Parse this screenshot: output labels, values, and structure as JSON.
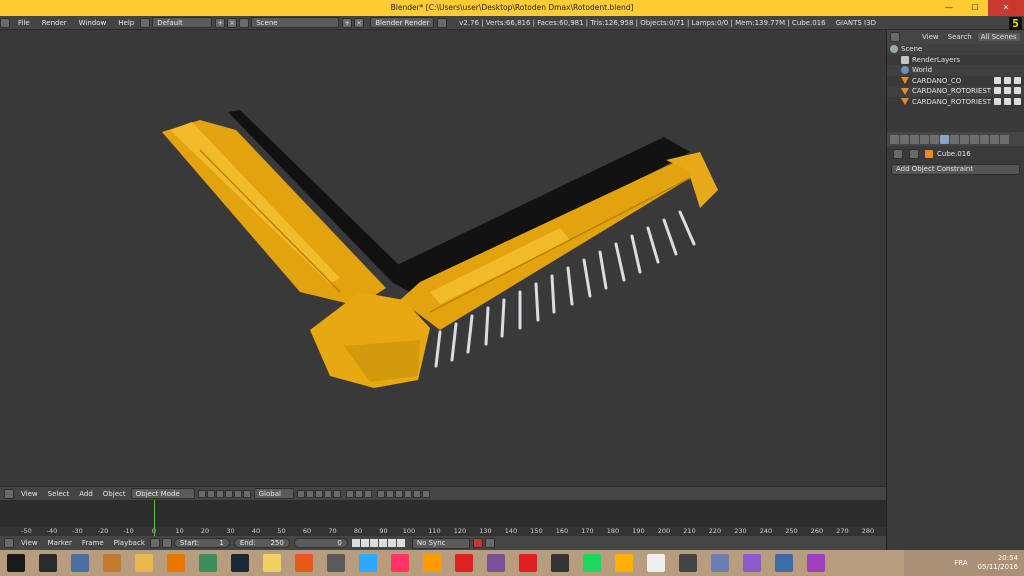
{
  "window": {
    "title": "Blender* [C:\\Users\\user\\Desktop\\Rotoden Dmax\\Rotodent.blend]",
    "minimize": "—",
    "maximize": "☐",
    "close": "✕"
  },
  "infobar": {
    "menus": [
      "File",
      "Render",
      "Window",
      "Help"
    ],
    "layout": "Default",
    "scene": "Scene",
    "engine": "Blender Render",
    "stats": "v2.76 | Verts:66,816 | Faces:60,981 | Tris:126,958 | Objects:0/71 | Lamps:0/0 | Mem:139.77M | Cube.016",
    "addon": "GIANTS I3D",
    "badge": "5"
  },
  "outliner": {
    "tabs": [
      "View",
      "Search",
      "All Scenes"
    ],
    "rows": [
      {
        "label": "Scene",
        "icon": "scene-icon"
      },
      {
        "label": "RenderLayers",
        "icon": "renderlayers-icon"
      },
      {
        "label": "World",
        "icon": "world-icon"
      },
      {
        "label": "CARDANO_CO",
        "icon": "mesh-icon"
      },
      {
        "label": "CARDANO_ROTORIEST",
        "icon": "mesh-icon"
      },
      {
        "label": "CARDANO_ROTORIEST",
        "icon": "mesh-icon"
      }
    ]
  },
  "properties": {
    "object": "Cube.016",
    "add_constraint": "Add Object Constraint"
  },
  "view3d_header": {
    "menus": [
      "View",
      "Select",
      "Add",
      "Object"
    ],
    "mode": "Object Mode",
    "orientation": "Global"
  },
  "timeline": {
    "ticks": [
      "-50",
      "-40",
      "-30",
      "-20",
      "-10",
      "0",
      "10",
      "20",
      "30",
      "40",
      "50",
      "60",
      "70",
      "80",
      "90",
      "100",
      "110",
      "120",
      "130",
      "140",
      "150",
      "160",
      "170",
      "180",
      "190",
      "200",
      "210",
      "220",
      "230",
      "240",
      "250",
      "260",
      "270",
      "280"
    ],
    "current_frame": 0
  },
  "timeline_header": {
    "menus": [
      "View",
      "Marker",
      "Frame",
      "Playback"
    ],
    "start_label": "Start:",
    "start": "1",
    "end_label": "End:",
    "end": "250",
    "frame": "0",
    "sync": "No Sync"
  },
  "taskbar": {
    "apps": [
      "start-icon",
      "search-icon",
      "file-explorer-icon",
      "app-icon",
      "folder-icon",
      "blender-icon",
      "gallery-icon",
      "steam-icon",
      "notes-icon",
      "firefox-icon",
      "tools-icon",
      "photoshop-icon",
      "indesign-icon",
      "illustrator-icon",
      "acrobat-icon",
      "viber-icon",
      "app-red-icon",
      "game-icon",
      "spotify-icon",
      "paint-icon",
      "app-white-icon",
      "pin-icon",
      "map-icon",
      "app-purple-icon",
      "browser-icon",
      "search-purple-icon"
    ],
    "lang": "FRA",
    "time": "20:54",
    "date": "05/11/2016"
  },
  "colors": {
    "titlebar": "#ffcc33",
    "model_yellow": "#e7a811",
    "model_black": "#111111",
    "tines": "#d9dde3"
  }
}
